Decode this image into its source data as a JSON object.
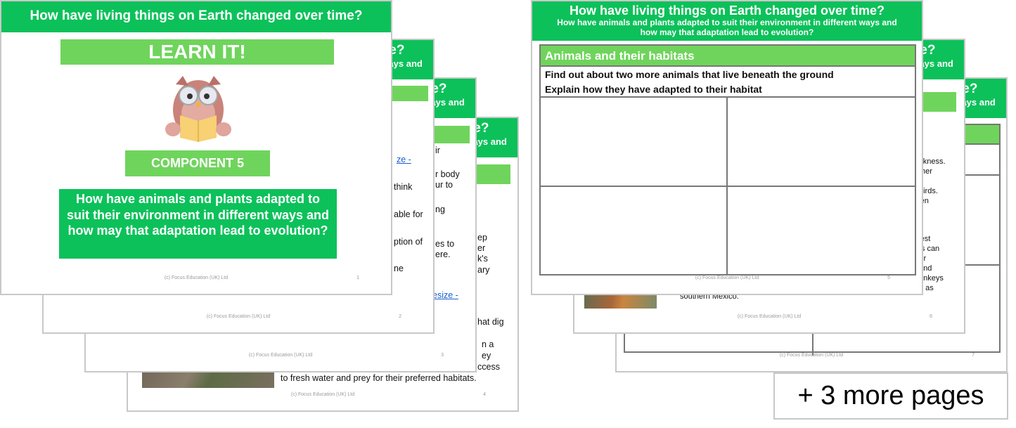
{
  "topic_title": "How have living things on Earth changed over time?",
  "topic_subtitle": "How have animals and plants adapted to suit their environment in different ways and how may that adaptation lead to evolution?",
  "subtitle_line1": "How have animals and plants adapted to suit their environment in different ways and",
  "subtitle_line2": "how may that adaptation lead to evolution?",
  "footer": "(c) Focus Education (UK) Ltd",
  "colors": {
    "header_green": "#0cc15a",
    "light_green": "#6fd45c",
    "link": "#1a5fd0"
  },
  "slide1": {
    "banner": "LEARN IT!",
    "icon": "owl-reading-icon",
    "component": "COMPONENT 5",
    "question": "How have animals and plants adapted to suit their environment in different ways and how may that adaptation lead to evolution?",
    "page": "1"
  },
  "slide2": {
    "page": "2",
    "fragments": [
      "ze -",
      "think",
      "able for",
      "ption of",
      "ne"
    ]
  },
  "slide3": {
    "page": "3",
    "fragments": [
      "ir",
      "r body",
      "ur to",
      "ng",
      "es to",
      "ere.",
      "esize -"
    ]
  },
  "slide4": {
    "page": "4",
    "fragments": [
      "ep",
      "er",
      "k's",
      "ary",
      "hat dig",
      "n a",
      "ey",
      "ccess",
      "to fresh water and prey for their preferred habitats."
    ]
  },
  "slide5": {
    "page": "5",
    "section": "Animals and their habitats",
    "task1": "Find out about two more animals that live beneath the ground",
    "task2": "Explain how they have adapted to their habitat"
  },
  "slide6": {
    "page": "6",
    "fragments": [
      "arkness.",
      "ther",
      "f",
      "birds.",
      "ren",
      "rest",
      "ils can",
      "eir",
      "and",
      "onkeys",
      "n as",
      "southern Mexico."
    ]
  },
  "slide7": {
    "page": "7"
  },
  "more_pages": "+ 3 more pages"
}
